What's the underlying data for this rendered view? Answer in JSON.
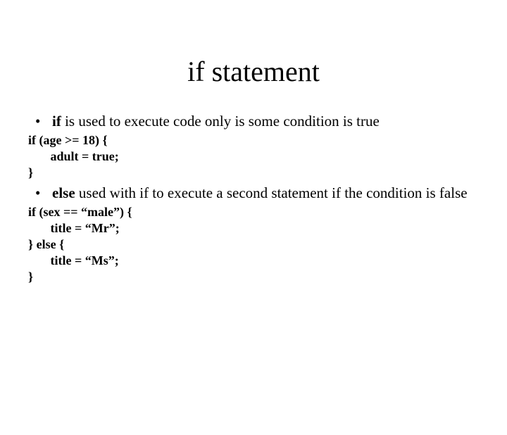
{
  "title": "if statement",
  "bullet1": {
    "strong": "if",
    "rest": " is used to execute code only is some condition is true"
  },
  "code1": {
    "l1": "if (age >= 18) {",
    "l2": "       adult = true;",
    "l3": "}"
  },
  "bullet2": {
    "strong": "else",
    "rest": " used with if to execute a second statement if the condition is false"
  },
  "code2": {
    "l1": "if (sex == “male”) {",
    "l2": "       title = “Mr”;",
    "l3": "} else {",
    "l4": "       title = “Ms”;",
    "l5": "}"
  }
}
